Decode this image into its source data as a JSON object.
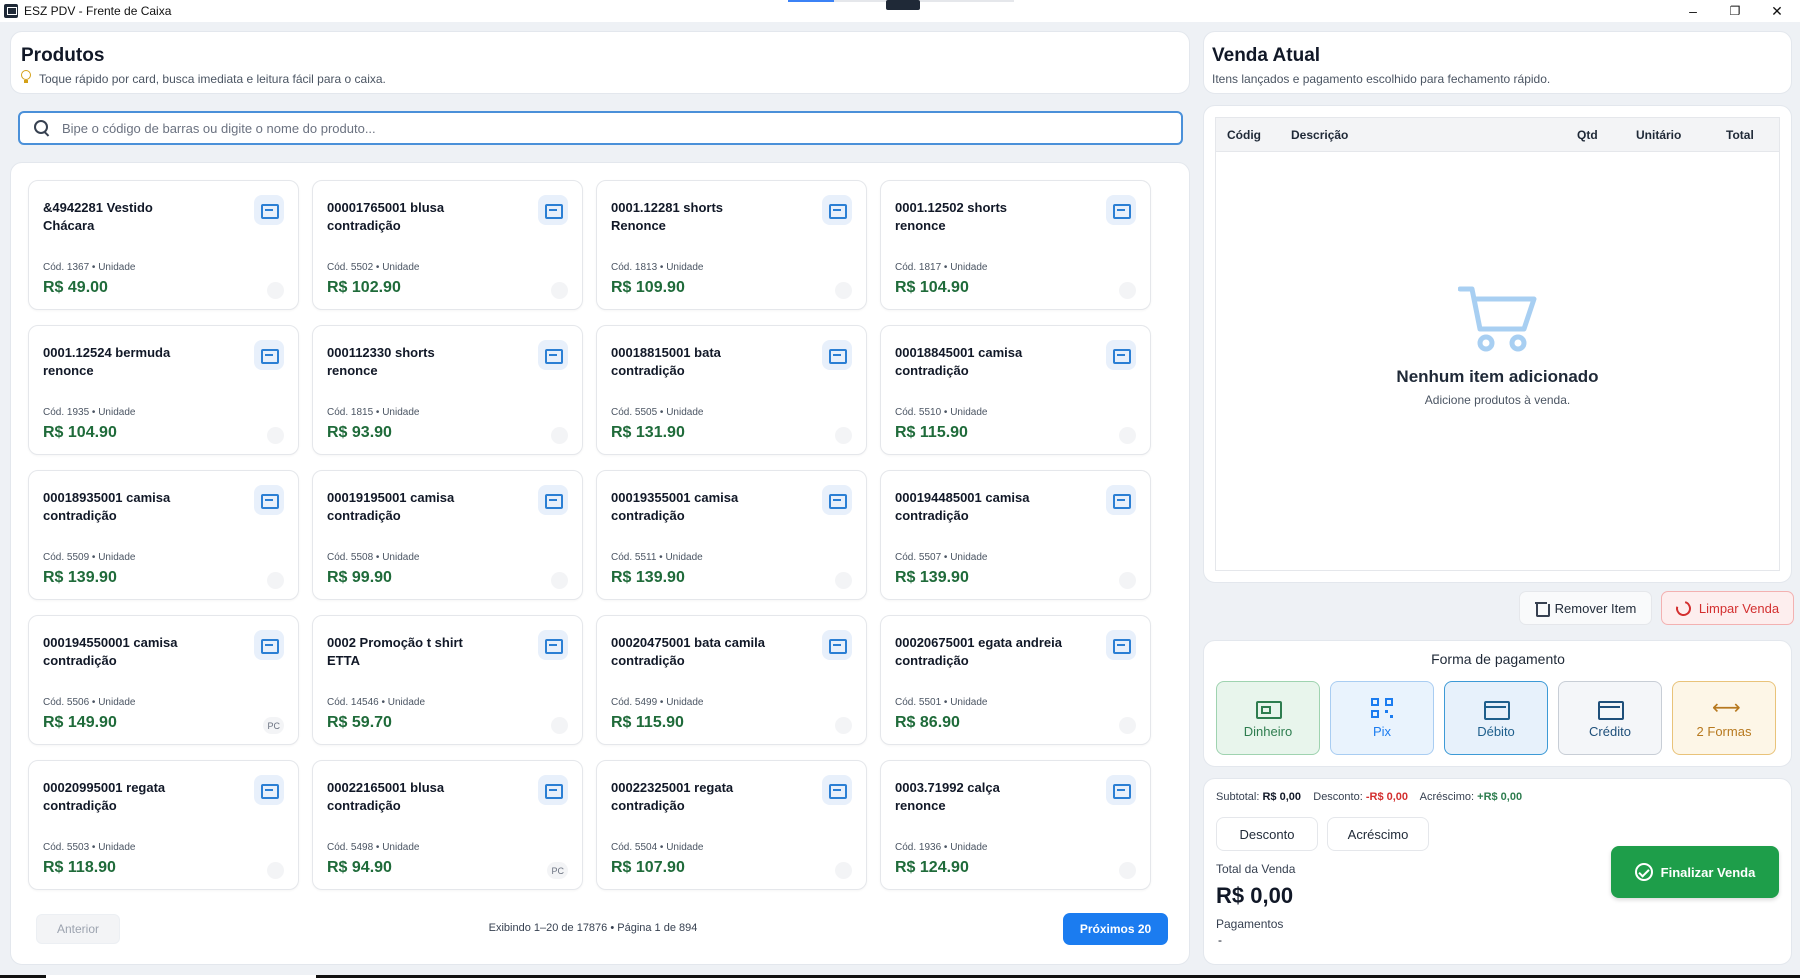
{
  "window": {
    "title": "ESZ PDV - Frente de Caixa",
    "minimize_glyph": "–",
    "restore_glyph": "❐",
    "close_glyph": "✕"
  },
  "products": {
    "title": "Produtos",
    "subtitle": "Toque rápido por card, busca imediata e leitura fácil para o caixa.",
    "search_placeholder": "Bipe o código de barras ou digite o nome do produto...",
    "items": [
      {
        "name": "&4942281  Vestido\nChácara",
        "meta": "Cód. 1367 • Unidade",
        "price": "R$ 49.00",
        "tag": ""
      },
      {
        "name": "00001765001  blusa\ncontradição",
        "meta": "Cód. 5502 • Unidade",
        "price": "R$ 102.90",
        "tag": ""
      },
      {
        "name": "0001.12281  shorts\nRenonce",
        "meta": "Cód. 1813 • Unidade",
        "price": "R$ 109.90",
        "tag": ""
      },
      {
        "name": "0001.12502  shorts\nrenonce",
        "meta": "Cód. 1817 • Unidade",
        "price": "R$ 104.90",
        "tag": ""
      },
      {
        "name": "0001.12524  bermuda\nrenonce",
        "meta": "Cód. 1935 • Unidade",
        "price": "R$ 104.90",
        "tag": ""
      },
      {
        "name": "000112330  shorts\nrenonce",
        "meta": "Cód. 1815 • Unidade",
        "price": "R$ 93.90",
        "tag": ""
      },
      {
        "name": "00018815001  bata\ncontradição",
        "meta": "Cód. 5505 • Unidade",
        "price": "R$ 131.90",
        "tag": ""
      },
      {
        "name": "00018845001  camisa\ncontradição",
        "meta": "Cód. 5510 • Unidade",
        "price": "R$ 115.90",
        "tag": ""
      },
      {
        "name": "00018935001  camisa\ncontradição",
        "meta": "Cód. 5509 • Unidade",
        "price": "R$ 139.90",
        "tag": ""
      },
      {
        "name": "00019195001  camisa\ncontradição",
        "meta": "Cód. 5508 • Unidade",
        "price": "R$ 99.90",
        "tag": ""
      },
      {
        "name": "00019355001  camisa\ncontradição",
        "meta": "Cód. 5511 • Unidade",
        "price": "R$ 139.90",
        "tag": ""
      },
      {
        "name": "000194485001  camisa\ncontradição",
        "meta": "Cód. 5507 • Unidade",
        "price": "R$ 139.90",
        "tag": ""
      },
      {
        "name": "000194550001  camisa\ncontradição",
        "meta": "Cód. 5506 • Unidade",
        "price": "R$ 149.90",
        "tag": "PC"
      },
      {
        "name": "0002 Promoção  t shirt\nETTA",
        "meta": "Cód. 14546 • Unidade",
        "price": "R$ 59.70",
        "tag": ""
      },
      {
        "name": "00020475001  bata  camila\ncontradição",
        "meta": "Cód. 5499 • Unidade",
        "price": "R$ 115.90",
        "tag": ""
      },
      {
        "name": "00020675001  egata andreia\ncontradição",
        "meta": "Cód. 5501 • Unidade",
        "price": "R$ 86.90",
        "tag": ""
      },
      {
        "name": "00020995001  regata\ncontradição",
        "meta": "Cód. 5503 • Unidade",
        "price": "R$ 118.90",
        "tag": ""
      },
      {
        "name": "00022165001  blusa\ncontradição",
        "meta": "Cód. 5498 • Unidade",
        "price": "R$ 94.90",
        "tag": "PC"
      },
      {
        "name": "00022325001  regata\ncontradição",
        "meta": "Cód. 5504 • Unidade",
        "price": "R$ 107.90",
        "tag": ""
      },
      {
        "name": "0003.71992  calça\nrenonce",
        "meta": "Cód. 1936 • Unidade",
        "price": "R$ 124.90",
        "tag": ""
      }
    ],
    "pagination": {
      "prev_label": "Anterior",
      "info": "Exibindo 1–20 de 17876  •  Página 1 de 894",
      "next_label": "Próximos 20"
    }
  },
  "sale": {
    "title": "Venda Atual",
    "subtitle": "Itens lançados e pagamento escolhido para fechamento rápido.",
    "columns": [
      "Códig",
      "Descrição",
      "Qtd",
      "Unitário",
      "Total"
    ],
    "empty_title": "Nenhum item adicionado",
    "empty_subtitle": "Adicione produtos à venda.",
    "remove_label": "Remover Item",
    "clear_label": "Limpar Venda"
  },
  "payment": {
    "title": "Forma de pagamento",
    "methods": [
      {
        "label": "Dinheiro",
        "icon": "cash-icon",
        "bg": "#e8f5ec",
        "border": "#9fd3b0",
        "color": "#2e7d4f"
      },
      {
        "label": "Pix",
        "icon": "qr-code-icon",
        "bg": "#e9f3fd",
        "border": "#a9cdf2",
        "color": "#1b7cf0"
      },
      {
        "label": "Débito",
        "icon": "debit-card-icon",
        "bg": "#e7f1fb",
        "border": "#3d9ad6",
        "color": "#1e5f8c"
      },
      {
        "label": "Crédito",
        "icon": "credit-card-icon",
        "bg": "#f4f6f9",
        "border": "#c8ced6",
        "color": "#1e4f7a"
      },
      {
        "label": "2 Formas",
        "icon": "split-arrows-icon",
        "bg": "#fdf6e7",
        "border": "#e9c37a",
        "color": "#b7791f"
      }
    ]
  },
  "totals": {
    "subtotal_label": "Subtotal:",
    "subtotal_value": "R$ 0,00",
    "discount_label": "Desconto:",
    "discount_value": "-R$ 0,00",
    "surcharge_label": "Acréscimo:",
    "surcharge_value": "+R$ 0,00",
    "discount_button": "Desconto",
    "surcharge_button": "Acréscimo",
    "total_label": "Total da Venda",
    "total_value": "R$ 0,00",
    "payments_label": "Pagamentos",
    "payments_value": "-",
    "finish_label": "Finalizar Venda"
  }
}
